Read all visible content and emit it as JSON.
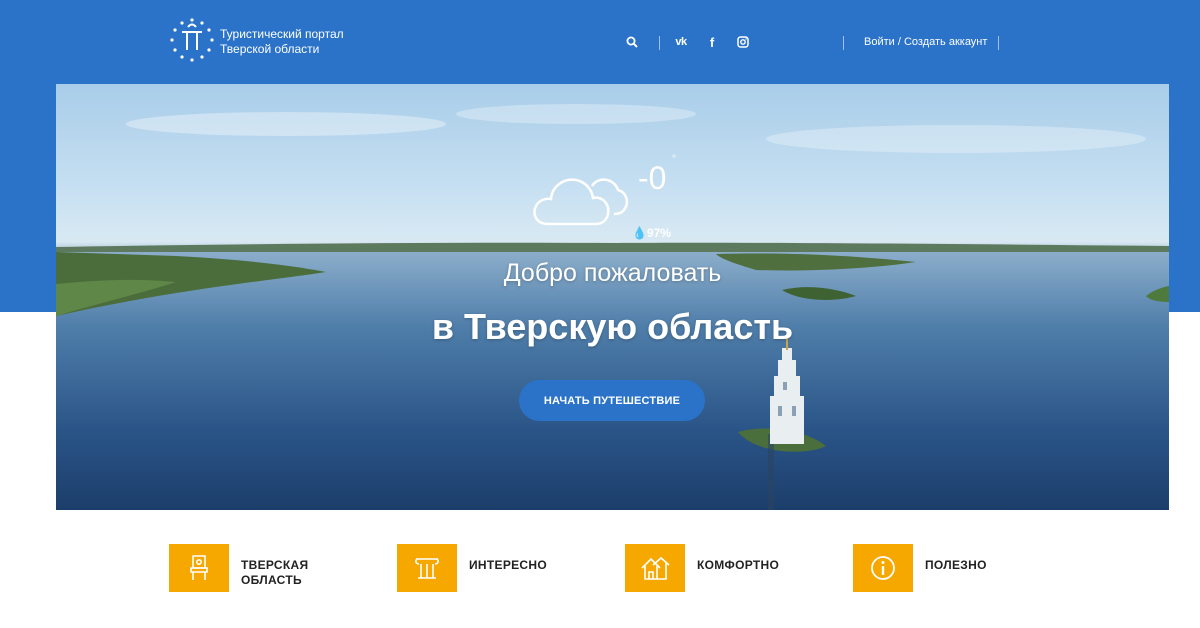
{
  "header": {
    "logo_line1": "Туристический портал",
    "logo_line2": "Тверской области",
    "login_label": "Войти",
    "register_label": "Создать аккаунт",
    "login_sep": " / ",
    "icons": [
      "search-icon",
      "vk-icon",
      "facebook-icon",
      "instagram-icon"
    ]
  },
  "hero": {
    "weather": {
      "temperature": "-0",
      "degree": "°",
      "humidity": "97%"
    },
    "welcome_line1": "Добро пожаловать",
    "welcome_line2": "в Тверскую область",
    "cta_label": "НАЧАТЬ ПУТЕШЕСТВИЕ"
  },
  "categories": [
    {
      "line1": "ТВЕРСКАЯ",
      "line2": "ОБЛАСТЬ",
      "icon": "chair-icon"
    },
    {
      "line1": "ИНТЕРЕСНО",
      "line2": "",
      "icon": "column-icon"
    },
    {
      "line1": "КОМФОРТНО",
      "line2": "",
      "icon": "houses-icon"
    },
    {
      "line1": "ПОЛЕЗНО",
      "line2": "",
      "icon": "info-icon"
    }
  ],
  "colors": {
    "brand_blue": "#2a73c9",
    "accent_orange": "#f6a800"
  }
}
